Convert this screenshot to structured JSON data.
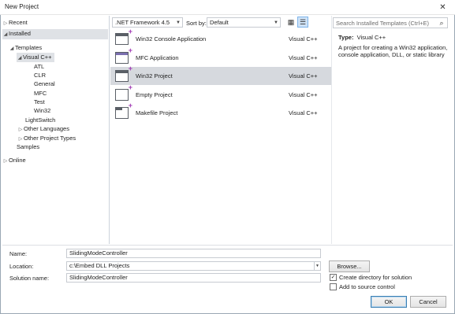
{
  "window": {
    "title": "New Project",
    "close_glyph": "✕"
  },
  "left_tree": {
    "recent": "Recent",
    "installed": "Installed",
    "templates": "Templates",
    "visual_cpp": "Visual C++",
    "atl": "ATL",
    "clr": "CLR",
    "general": "General",
    "mfc": "MFC",
    "test": "Test",
    "win32": "Win32",
    "lightswitch": "LightSwitch",
    "other_languages": "Other Languages",
    "other_project_types": "Other Project Types",
    "samples": "Samples",
    "online": "Online"
  },
  "toolbar": {
    "framework": ".NET Framework 4.5",
    "sort_by_label": "Sort by:",
    "sort_by_value": "Default"
  },
  "search": {
    "placeholder": "Search Installed Templates (Ctrl+E)"
  },
  "templates": [
    {
      "name": "Win32 Console Application",
      "lang": "Visual C++",
      "icon": "console-app-icon"
    },
    {
      "name": "MFC Application",
      "lang": "Visual C++",
      "icon": "mfc-app-icon"
    },
    {
      "name": "Win32 Project",
      "lang": "Visual C++",
      "icon": "win32-project-icon"
    },
    {
      "name": "Empty Project",
      "lang": "Visual C++",
      "icon": "empty-project-icon"
    },
    {
      "name": "Makefile Project",
      "lang": "Visual C++",
      "icon": "makefile-project-icon"
    }
  ],
  "details": {
    "type_label": "Type:",
    "type_value": "Visual C++",
    "description": "A project for creating a Win32 application, console application, DLL, or static library"
  },
  "form": {
    "name_label": "Name:",
    "name_value": "SlidingModeController",
    "location_label": "Location:",
    "location_value": "c:\\Embed DLL Projects",
    "solution_label": "Solution name:",
    "solution_value": "SlidingModeController",
    "browse": "Browse...",
    "create_dir": "Create directory for solution",
    "create_dir_checked": true,
    "add_source": "Add to source control",
    "add_source_checked": false,
    "ok": "OK",
    "cancel": "Cancel"
  }
}
